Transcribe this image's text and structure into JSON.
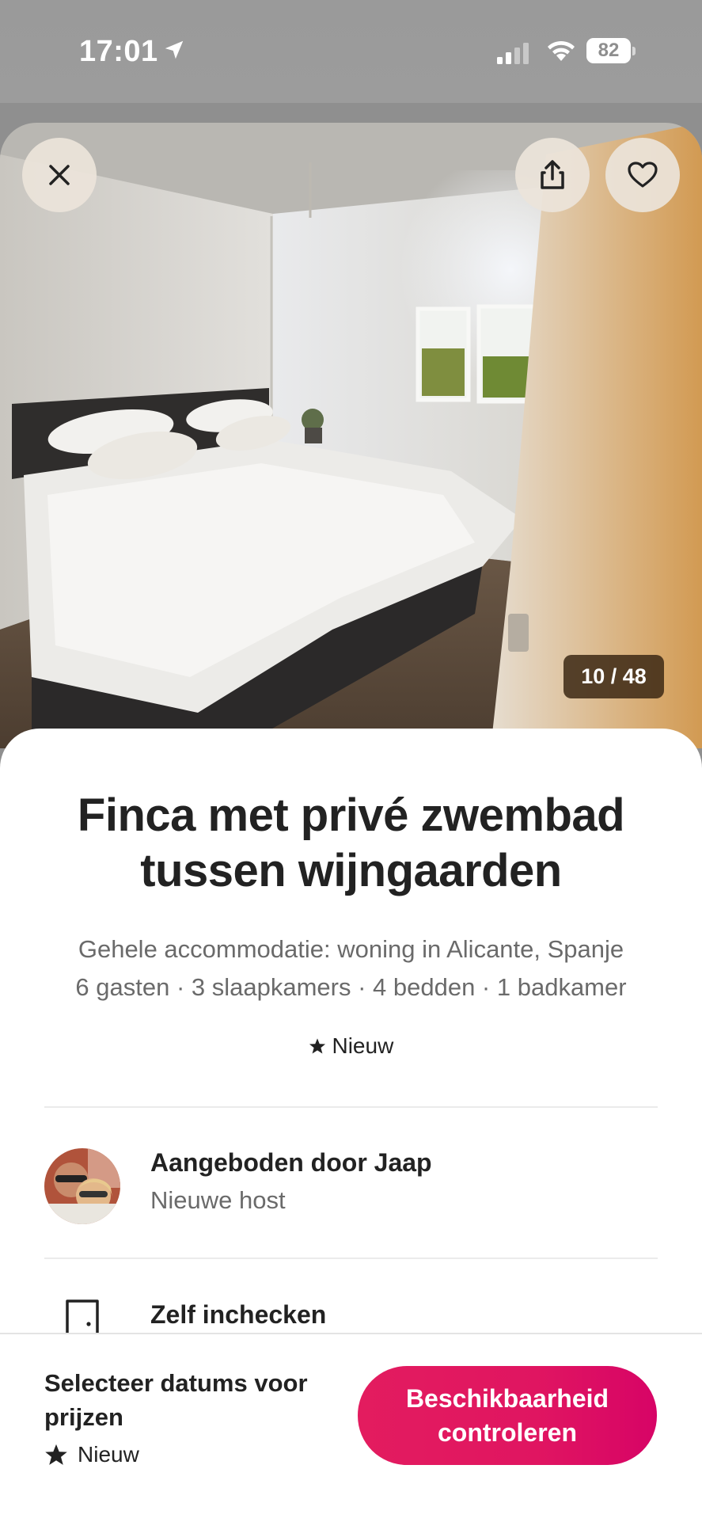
{
  "status_bar": {
    "time": "17:01",
    "battery": "82"
  },
  "gallery": {
    "counter": "10 / 48",
    "icons": [
      "close-icon",
      "share-icon",
      "heart-icon"
    ]
  },
  "listing": {
    "title": "Finca met privé zwembad tussen wijngaarden",
    "subtitle_line1": "Gehele accommodatie: woning in Alicante, Spanje",
    "subtitle_line2": "6 gasten · 3 slaapkamers · 4 bedden · 1 badkamer",
    "rating_label": "Nieuw"
  },
  "host": {
    "name": "Aangeboden door Jaap",
    "status": "Nieuwe host"
  },
  "highlights": {
    "checkin": "Zelf inchecken"
  },
  "footer": {
    "price_label": "Selecteer datums voor prijzen",
    "rating_label": "Nieuw",
    "cta_line1": "Beschikbaarheid",
    "cta_line2": "controleren"
  },
  "colors": {
    "accent": "#E31C5F",
    "text": "#222222",
    "muted": "#6A6A6A"
  }
}
